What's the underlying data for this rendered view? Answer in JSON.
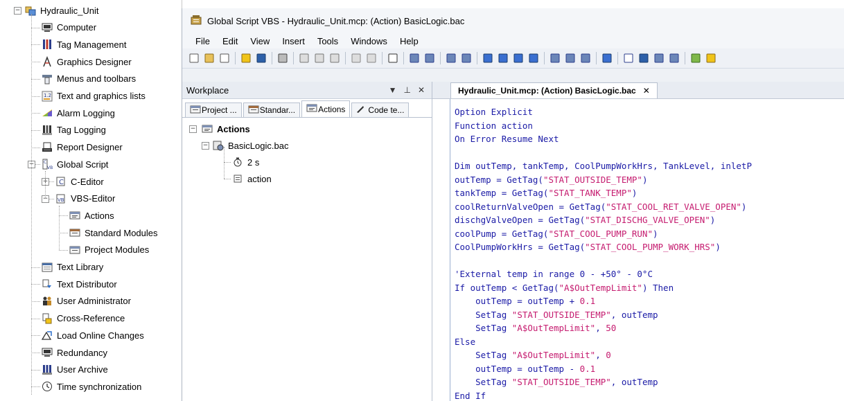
{
  "tree": {
    "root": "Hydraulic_Unit",
    "items": [
      {
        "label": "Computer",
        "icon": "computer-icon"
      },
      {
        "label": "Tag Management",
        "icon": "tag-management-icon"
      },
      {
        "label": "Graphics Designer",
        "icon": "graphics-designer-icon"
      },
      {
        "label": "Menus and toolbars",
        "icon": "menus-toolbars-icon"
      },
      {
        "label": "Text and graphics lists",
        "icon": "text-graphics-lists-icon"
      },
      {
        "label": "Alarm Logging",
        "icon": "alarm-logging-icon"
      },
      {
        "label": "Tag Logging",
        "icon": "tag-logging-icon"
      },
      {
        "label": "Report Designer",
        "icon": "report-designer-icon"
      },
      {
        "label": "Global Script",
        "icon": "global-script-icon"
      },
      {
        "label": "C-Editor",
        "icon": "c-editor-icon"
      },
      {
        "label": "VBS-Editor",
        "icon": "vbs-editor-icon"
      },
      {
        "label": "Actions",
        "icon": "actions-icon"
      },
      {
        "label": "Standard Modules",
        "icon": "standard-modules-icon"
      },
      {
        "label": "Project Modules",
        "icon": "project-modules-icon"
      },
      {
        "label": "Text Library",
        "icon": "text-library-icon"
      },
      {
        "label": "Text Distributor",
        "icon": "text-distributor-icon"
      },
      {
        "label": "User Administrator",
        "icon": "user-administrator-icon"
      },
      {
        "label": "Cross-Reference",
        "icon": "cross-reference-icon"
      },
      {
        "label": "Load Online Changes",
        "icon": "load-online-changes-icon"
      },
      {
        "label": "Redundancy",
        "icon": "redundancy-icon"
      },
      {
        "label": "User Archive",
        "icon": "user-archive-icon"
      },
      {
        "label": "Time synchronization",
        "icon": "time-sync-icon"
      }
    ]
  },
  "window": {
    "title": "Global Script VBS - Hydraulic_Unit.mcp: (Action) BasicLogic.bac",
    "menu": [
      "File",
      "Edit",
      "View",
      "Insert",
      "Tools",
      "Windows",
      "Help"
    ]
  },
  "workplace": {
    "title": "Workplace",
    "pin": "▾ ⊥ ✕",
    "tabs": [
      "Project ...",
      "Standar...",
      "Actions",
      "Code te..."
    ],
    "tree": {
      "root": "Actions",
      "file": "BasicLogic.bac",
      "trigger": "2 s",
      "action": "action"
    }
  },
  "editor": {
    "tab": "Hydraulic_Unit.mcp: (Action) BasicLogic.bac",
    "tab_close": "✕",
    "lines": [
      [
        [
          "kw",
          "Option Explicit"
        ]
      ],
      [
        [
          "kw",
          "Function action"
        ]
      ],
      [
        [
          "kw",
          "On Error Resume Next"
        ]
      ],
      [],
      [
        [
          "kw",
          "Dim "
        ],
        [
          "id",
          "outTemp, tankTemp, CoolPumpWorkHrs, TankLevel, inletP"
        ]
      ],
      [
        [
          "id",
          "outTemp = GetTag("
        ],
        [
          "str",
          "\"STAT_OUTSIDE_TEMP\""
        ],
        [
          "id",
          ")"
        ]
      ],
      [
        [
          "id",
          "tankTemp = GetTag("
        ],
        [
          "str",
          "\"STAT_TANK_TEMP\""
        ],
        [
          "id",
          ")"
        ]
      ],
      [
        [
          "id",
          "coolReturnValveOpen = GetTag("
        ],
        [
          "str",
          "\"STAT_COOL_RET_VALVE_OPEN\""
        ],
        [
          "id",
          ")"
        ]
      ],
      [
        [
          "id",
          "dischgValveOpen = GetTag("
        ],
        [
          "str",
          "\"STAT_DISCHG_VALVE_OPEN\""
        ],
        [
          "id",
          ")"
        ]
      ],
      [
        [
          "id",
          "coolPump = GetTag("
        ],
        [
          "str",
          "\"STAT_COOL_PUMP_RUN\""
        ],
        [
          "id",
          ")"
        ]
      ],
      [
        [
          "id",
          "CoolPumpWorkHrs = GetTag("
        ],
        [
          "str",
          "\"STAT_COOL_PUMP_WORK_HRS\""
        ],
        [
          "id",
          ")"
        ]
      ],
      [],
      [
        [
          "cm",
          "'External temp in range 0 - +50° - 0°C"
        ]
      ],
      [
        [
          "kw",
          "If "
        ],
        [
          "id",
          "outTemp < GetTag("
        ],
        [
          "str",
          "\"A$OutTempLimit\""
        ],
        [
          "id",
          ") "
        ],
        [
          "kw",
          "Then"
        ]
      ],
      [
        [
          "id",
          "    outTemp = outTemp + "
        ],
        [
          "num",
          "0.1"
        ]
      ],
      [
        [
          "id",
          "    SetTag "
        ],
        [
          "str",
          "\"STAT_OUTSIDE_TEMP\""
        ],
        [
          "id",
          ", outTemp"
        ]
      ],
      [
        [
          "id",
          "    SetTag "
        ],
        [
          "str",
          "\"A$OutTempLimit\""
        ],
        [
          "id",
          ", "
        ],
        [
          "num",
          "50"
        ]
      ],
      [
        [
          "kw",
          "Else"
        ]
      ],
      [
        [
          "id",
          "    SetTag "
        ],
        [
          "str",
          "\"A$OutTempLimit\""
        ],
        [
          "id",
          ", "
        ],
        [
          "num",
          "0"
        ]
      ],
      [
        [
          "id",
          "    outTemp = outTemp - "
        ],
        [
          "num",
          "0.1"
        ]
      ],
      [
        [
          "id",
          "    SetTag "
        ],
        [
          "str",
          "\"STAT_OUTSIDE_TEMP\""
        ],
        [
          "id",
          ", outTemp"
        ]
      ],
      [
        [
          "kw",
          "End If"
        ]
      ]
    ]
  }
}
